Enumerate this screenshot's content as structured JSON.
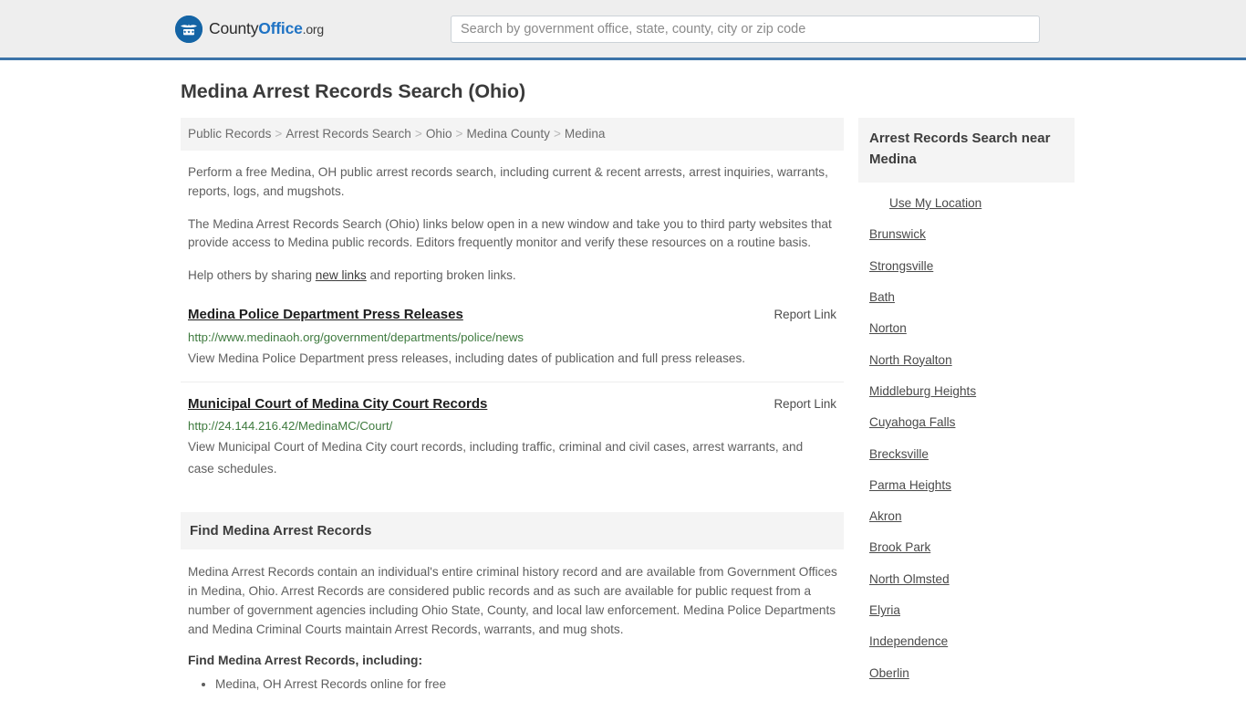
{
  "header": {
    "logo": {
      "icon": "eagle-shield-logo",
      "text_part1": "County",
      "text_part2": "Office",
      "text_part3": ".org"
    },
    "search": {
      "placeholder": "Search by government office, state, county, city or zip code",
      "value": "",
      "icon": "search-icon"
    },
    "accent_color": "#3b73a8",
    "background_color": "#eeeeee"
  },
  "page": {
    "title": "Medina Arrest Records Search (Ohio)"
  },
  "breadcrumb": {
    "separator": ">",
    "items": [
      {
        "label": "Public Records"
      },
      {
        "label": "Arrest Records Search"
      },
      {
        "label": "Ohio"
      },
      {
        "label": "Medina County"
      },
      {
        "label": "Medina"
      }
    ]
  },
  "intro": {
    "p1": "Perform a free Medina, OH public arrest records search, including current & recent arrests, arrest inquiries, warrants, reports, logs, and mugshots.",
    "p2": "The Medina Arrest Records Search (Ohio) links below open in a new window and take you to third party websites that provide access to Medina public records. Editors frequently monitor and verify these resources on a routine basis.",
    "p3_before": "Help others by sharing ",
    "p3_link": "new links",
    "p3_after": " and reporting broken links."
  },
  "results": [
    {
      "title": "Medina Police Department Press Releases",
      "report_label": "Report Link",
      "url": "http://www.medinaoh.org/government/departments/police/news",
      "description": "View Medina Police Department press releases, including dates of publication and full press releases."
    },
    {
      "title": "Municipal Court of Medina City Court Records",
      "report_label": "Report Link",
      "url": "http://24.144.216.42/MedinaMC/Court/",
      "description": "View Municipal Court of Medina City court records, including traffic, criminal and civil cases, arrest warrants, and case schedules."
    }
  ],
  "section": {
    "heading": "Find Medina Arrest Records",
    "body": "Medina Arrest Records contain an individual's entire criminal history record and are available from Government Offices in Medina, Ohio. Arrest Records are considered public records and as such are available for public request from a number of government agencies including Ohio State, County, and local law enforcement. Medina Police Departments and Medina Criminal Courts maintain Arrest Records, warrants, and mug shots.",
    "subheading": "Find Medina Arrest Records, including:",
    "list": [
      "Medina, OH Arrest Records online for free"
    ]
  },
  "sidebar": {
    "heading": "Arrest Records Search near Medina",
    "use_location": "Use My Location",
    "items": [
      {
        "label": "Brunswick"
      },
      {
        "label": "Strongsville"
      },
      {
        "label": "Bath"
      },
      {
        "label": "Norton"
      },
      {
        "label": "North Royalton"
      },
      {
        "label": "Middleburg Heights"
      },
      {
        "label": "Cuyahoga Falls"
      },
      {
        "label": "Brecksville"
      },
      {
        "label": "Parma Heights"
      },
      {
        "label": "Akron"
      },
      {
        "label": "Brook Park"
      },
      {
        "label": "North Olmsted"
      },
      {
        "label": "Elyria"
      },
      {
        "label": "Independence"
      },
      {
        "label": "Oberlin"
      }
    ]
  }
}
